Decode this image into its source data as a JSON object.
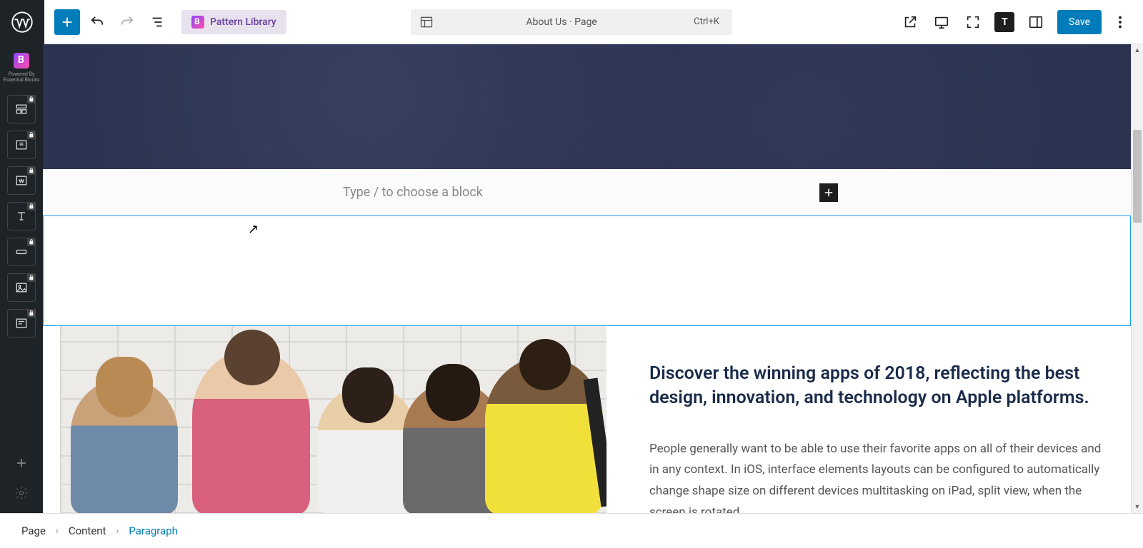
{
  "toolbar": {
    "pattern_library_label": "Pattern Library",
    "page_label": "About Us · Page",
    "shortcut": "Ctrl+K",
    "save_label": "Save"
  },
  "sidebar_brand": {
    "line1": "Powered By",
    "line2": "Essential Blocks"
  },
  "editor": {
    "block_placeholder": "Type / to choose a block"
  },
  "content": {
    "heading": "Discover the winning apps of 2018, reflecting the best design, innovation, and technology on Apple platforms.",
    "paragraph": "People generally want to be able to use their favorite apps on all of their devices and in any context. In iOS, interface elements layouts can be configured to automatically change shape size on different devices multitasking on iPad, split view, when the screen is rotated,"
  },
  "breadcrumb": {
    "segments": [
      "Page",
      "Content",
      "Paragraph"
    ]
  }
}
